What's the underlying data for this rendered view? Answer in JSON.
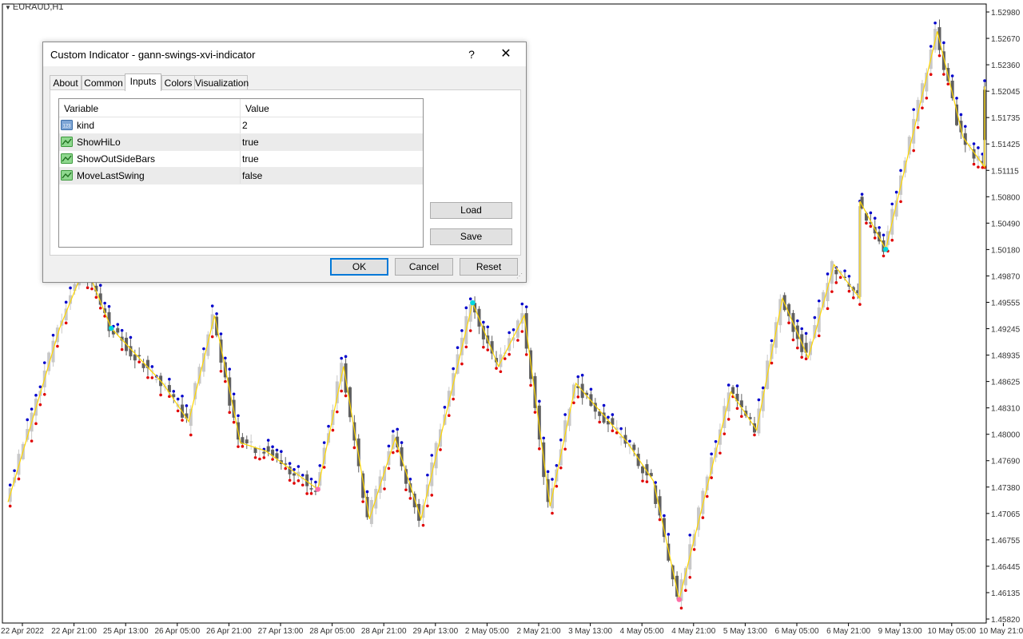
{
  "symbol": "EURAUD,H1",
  "price_axis": [
    "1.52980",
    "1.52670",
    "1.52360",
    "1.52045",
    "1.51735",
    "1.51425",
    "1.51115",
    "1.50800",
    "1.50490",
    "1.50180",
    "1.49870",
    "1.49555",
    "1.49245",
    "1.48935",
    "1.48625",
    "1.48310",
    "1.48000",
    "1.47690",
    "1.47380",
    "1.47065",
    "1.46755",
    "1.46445",
    "1.46135",
    "1.45820"
  ],
  "time_axis": [
    "22 Apr 2022",
    "22 Apr 21:00",
    "25 Apr 13:00",
    "26 Apr 05:00",
    "26 Apr 21:00",
    "27 Apr 13:00",
    "28 Apr 05:00",
    "28 Apr 21:00",
    "29 Apr 13:00",
    "2 May 05:00",
    "2 May 21:00",
    "3 May 13:00",
    "4 May 05:00",
    "4 May 21:00",
    "5 May 13:00",
    "6 May 05:00",
    "6 May 21:00",
    "9 May 13:00",
    "10 May 05:00",
    "10 May 21:00"
  ],
  "colors": {
    "zigzag": "#ffd700",
    "hi_dot": "#0000cc",
    "lo_dot": "#e00000",
    "swing_cyan": "#00d8e0",
    "swing_pink": "#ff6fa8",
    "bull_bar": "#c8c8c8",
    "bear_bar": "#606060",
    "dialog_accent": "#0078d7"
  },
  "dialog": {
    "title": "Custom Indicator - gann-swings-xvi-indicator",
    "help_label": "?",
    "close_label": "✕",
    "tabs": [
      {
        "label": "About",
        "active": false
      },
      {
        "label": "Common",
        "active": false
      },
      {
        "label": "Inputs",
        "active": true
      },
      {
        "label": "Colors",
        "active": false
      },
      {
        "label": "Visualization",
        "active": false
      }
    ],
    "grid": {
      "col_variable": "Variable",
      "col_value": "Value",
      "rows": [
        {
          "name": "kind",
          "value": "2",
          "icon": "integer-param-icon"
        },
        {
          "name": "ShowHiLo",
          "value": "true",
          "icon": "bool-param-icon"
        },
        {
          "name": "ShowOutSideBars",
          "value": "true",
          "icon": "bool-param-icon"
        },
        {
          "name": "MoveLastSwing",
          "value": "false",
          "icon": "bool-param-icon"
        }
      ]
    },
    "buttons": {
      "load": "Load",
      "save": "Save",
      "ok": "OK",
      "cancel": "Cancel",
      "reset": "Reset"
    }
  },
  "chart_data": {
    "type": "candlestick",
    "title": "EURAUD,H1",
    "ylim": [
      1.4582,
      1.5298
    ],
    "zigzag": [
      {
        "t": "22 Apr 2022",
        "price": 1.472
      },
      {
        "t": "22 Apr 21:00",
        "price": 1.4925
      },
      {
        "t": "25 Apr 05:00",
        "price": 1.5
      },
      {
        "t": "25 Apr 13:00",
        "price": 1.4925
      },
      {
        "t": "26 Apr 05:00",
        "price": 1.486
      },
      {
        "t": "26 Apr 13:00",
        "price": 1.4815
      },
      {
        "t": "26 Apr 21:00",
        "price": 1.494
      },
      {
        "t": "27 Apr 05:00",
        "price": 1.479
      },
      {
        "t": "27 Apr 13:00",
        "price": 1.478
      },
      {
        "t": "28 Apr 05:00",
        "price": 1.4735
      },
      {
        "t": "28 Apr 13:00",
        "price": 1.488
      },
      {
        "t": "28 Apr 21:00",
        "price": 1.47
      },
      {
        "t": "29 Apr 05:00",
        "price": 1.4795
      },
      {
        "t": "29 Apr 13:00",
        "price": 1.47
      },
      {
        "t": "2 May 05:00",
        "price": 1.4955
      },
      {
        "t": "2 May 13:00",
        "price": 1.488
      },
      {
        "t": "2 May 21:00",
        "price": 1.494
      },
      {
        "t": "3 May 05:00",
        "price": 1.4715
      },
      {
        "t": "3 May 13:00",
        "price": 1.486
      },
      {
        "t": "4 May 05:00",
        "price": 1.479
      },
      {
        "t": "4 May 13:00",
        "price": 1.4745
      },
      {
        "t": "4 May 21:00",
        "price": 1.4605
      },
      {
        "t": "5 May 13:00",
        "price": 1.485
      },
      {
        "t": "5 May 21:00",
        "price": 1.4805
      },
      {
        "t": "6 May 05:00",
        "price": 1.496
      },
      {
        "t": "6 May 13:00",
        "price": 1.489
      },
      {
        "t": "6 May 21:00",
        "price": 1.5
      },
      {
        "t": "7 May 05:00",
        "price": 1.496
      },
      {
        "t": "9 May 05:00",
        "price": 1.5075
      },
      {
        "t": "9 May 13:00",
        "price": 1.5018
      },
      {
        "t": "10 May 05:00",
        "price": 1.5275
      },
      {
        "t": "10 May 13:00",
        "price": 1.515
      },
      {
        "t": "10 May 21:00",
        "price": 1.5115
      },
      {
        "t": "11 May 05:00",
        "price": 1.521
      },
      {
        "t": "11 May 13:00",
        "price": 1.5145
      }
    ]
  }
}
